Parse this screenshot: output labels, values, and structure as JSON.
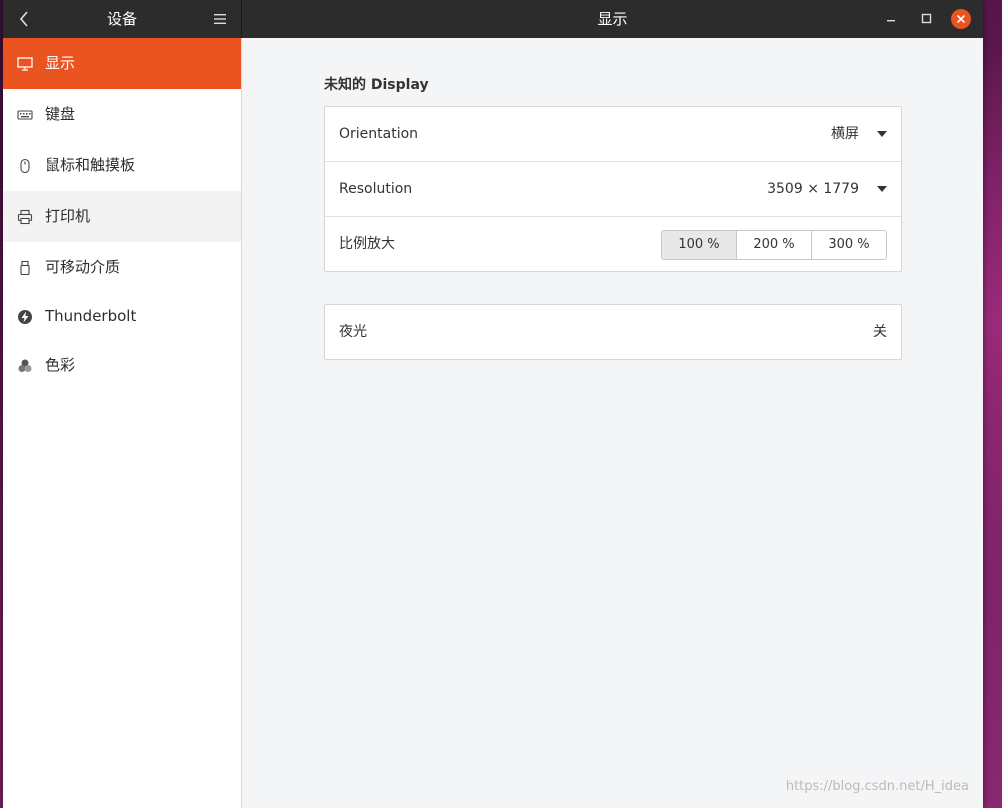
{
  "titlebar": {
    "left_title": "设备",
    "main_title": "显示"
  },
  "sidebar": {
    "items": [
      {
        "label": "显示",
        "icon": "display-icon"
      },
      {
        "label": "键盘",
        "icon": "keyboard-icon"
      },
      {
        "label": "鼠标和触摸板",
        "icon": "mouse-icon"
      },
      {
        "label": "打印机",
        "icon": "printer-icon"
      },
      {
        "label": "可移动介质",
        "icon": "usb-icon"
      },
      {
        "label": "Thunderbolt",
        "icon": "thunderbolt-icon"
      },
      {
        "label": "色彩",
        "icon": "color-icon"
      }
    ]
  },
  "display": {
    "section_title": "未知的 Display",
    "orientation_label": "Orientation",
    "orientation_value": "横屏",
    "resolution_label": "Resolution",
    "resolution_value": "3509 × 1779",
    "scale_label": "比例放大",
    "scale_options": [
      "100 %",
      "200 %",
      "300 %"
    ],
    "scale_selected": "100 %",
    "night_light_label": "夜光",
    "night_light_value": "关"
  },
  "watermark": "https://blog.csdn.net/H_idea",
  "colors": {
    "accent": "#e95420",
    "titlebar": "#2c2c2c"
  }
}
